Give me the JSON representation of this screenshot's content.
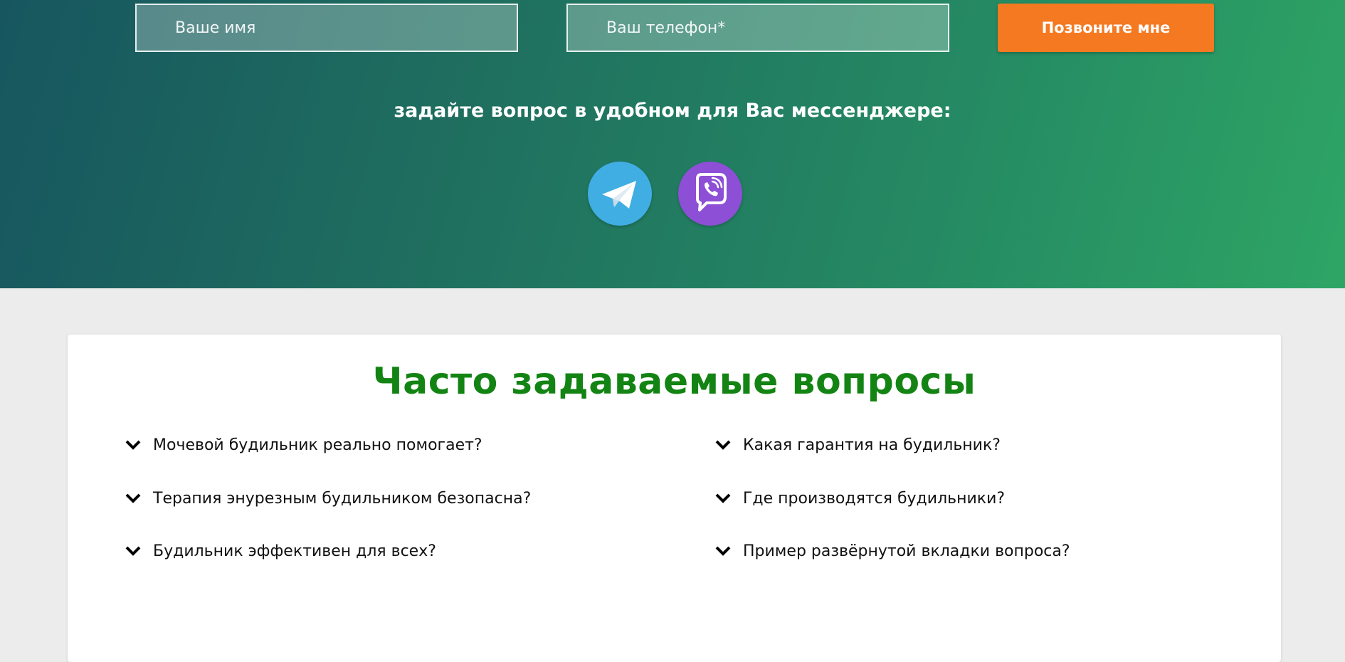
{
  "form": {
    "name_placeholder": "Ваше имя",
    "phone_placeholder": "Ваш телефон*",
    "call_button_label": "Позвоните мне",
    "button_color": "#f47920"
  },
  "messengers": {
    "title": "задайте вопрос в удобном для Вас мессенджере:",
    "items": [
      {
        "icon": "telegram-icon",
        "color": "#40aee3"
      },
      {
        "icon": "viber-icon",
        "color": "#8d4fd6"
      }
    ]
  },
  "faq": {
    "title": "Часто задаваемые вопросы",
    "title_color": "#138413",
    "icon": "chevron-down-icon",
    "left": [
      "Мочевой будильник реально помогает?",
      "Терапия энурезным будильником безопасна?",
      "Будильник эффективен для всех?"
    ],
    "right": [
      "Какая гарантия на будильник?",
      "Где производятся будильники?",
      "Пример развёрнутой вкладки вопроса?"
    ]
  }
}
